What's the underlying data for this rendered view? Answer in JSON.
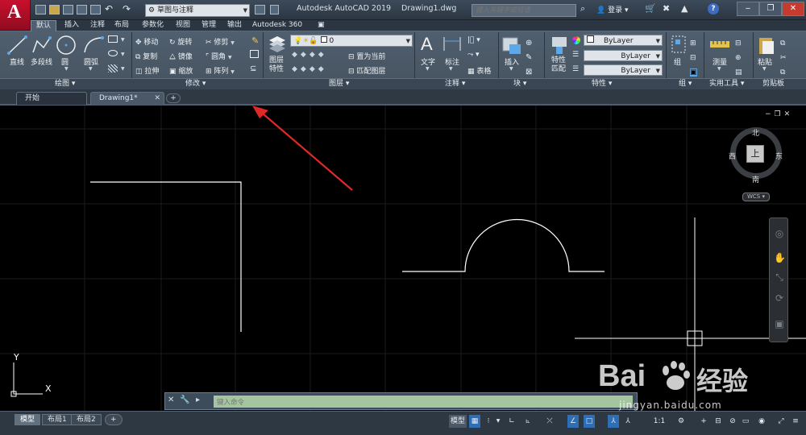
{
  "app": {
    "logo_letter": "A",
    "window_title": "Autodesk AutoCAD 2019",
    "document_title": "Drawing1.dwg",
    "workspace": "草图与注释",
    "search_placeholder": "键入关键字或短语",
    "signin_label": "登录",
    "help_label": "?"
  },
  "ribbon_tabs": [
    "默认",
    "插入",
    "注释",
    "布局",
    "参数化",
    "视图",
    "管理",
    "输出",
    "Autodesk 360",
    "▣"
  ],
  "ribbon": {
    "draw": {
      "line": "直线",
      "polyline": "多段线",
      "circle": "圆",
      "arc": "圆弧"
    },
    "modify": {
      "move": "移动",
      "rotate": "旋转",
      "trim": "修剪",
      "copy": "复制",
      "mirror": "镜像",
      "fillet": "圆角",
      "stretch": "拉伸",
      "scale": "缩放",
      "array": "阵列"
    },
    "layers": {
      "layer_props": "图层特性",
      "current_layer": "0",
      "make_current": "置为当前",
      "match_layer": "匹配图层"
    },
    "annotation": {
      "text": "文字",
      "dimension": "标注",
      "table": "表格"
    },
    "block": {
      "insert": "插入"
    },
    "properties": {
      "match": "特性匹配",
      "bylayer1": "ByLayer",
      "bylayer2": "ByLayer",
      "bylayer3": "ByLayer"
    },
    "groups": {
      "group": "组"
    },
    "utilities": {
      "measure": "测量"
    },
    "clipboard": {
      "paste": "粘贴"
    }
  },
  "panel_titles": {
    "draw": "绘图 ▾",
    "modify": "修改 ▾",
    "layers": "图层 ▾",
    "annotation": "注释 ▾",
    "block": "块 ▾",
    "properties": "特性 ▾",
    "groups": "组 ▾",
    "utilities": "实用工具 ▾",
    "clipboard": "剪贴板"
  },
  "doc_tabs": {
    "start": "开始",
    "drawing": "Drawing1*",
    "add": "+"
  },
  "viewcube": {
    "north": "北",
    "south": "南",
    "east": "东",
    "west": "西",
    "face": "上",
    "wcs": "WCS ▾"
  },
  "ucs": {
    "x": "X",
    "y": "Y"
  },
  "command_line": {
    "placeholder": "键入命令"
  },
  "layout_tabs": {
    "model": "模型",
    "layout1": "布局1",
    "layout2": "布局2",
    "add": "+"
  },
  "status": {
    "model": "模型",
    "scale": "1:1"
  },
  "watermark": {
    "brand": "Bai",
    "brand2": "经验",
    "url": "jingyan.baidu.com"
  },
  "colors": {
    "accent_red": "#d8262c",
    "ribbon": "#4b5866",
    "command_bg": "#a5c4a0"
  }
}
